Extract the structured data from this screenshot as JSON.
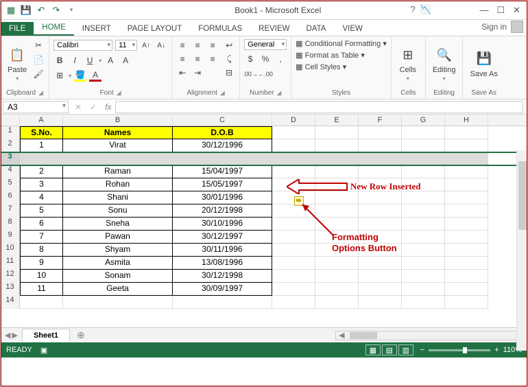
{
  "window": {
    "title": "Book1 - Microsoft Excel",
    "signin": "Sign in"
  },
  "qat": {
    "save": "💾",
    "undo": "↶",
    "redo": "↷"
  },
  "tabs": [
    "FILE",
    "HOME",
    "INSERT",
    "PAGE LAYOUT",
    "FORMULAS",
    "REVIEW",
    "DATA",
    "VIEW"
  ],
  "ribbon": {
    "clipboard": {
      "label": "Clipboard",
      "paste": "Paste"
    },
    "font": {
      "label": "Font",
      "name": "Calibri",
      "size": "11"
    },
    "alignment": {
      "label": "Alignment"
    },
    "number": {
      "label": "Number",
      "format": "General"
    },
    "styles": {
      "label": "Styles",
      "cond": "Conditional Formatting",
      "table": "Format as Table",
      "cell": "Cell Styles"
    },
    "cells": {
      "label": "Cells",
      "btn": "Cells"
    },
    "editing": {
      "label": "Editing",
      "btn": "Editing"
    },
    "saveas": {
      "label": "Save As",
      "btn": "Save As"
    }
  },
  "namebox": "A3",
  "columns": [
    "A",
    "B",
    "C",
    "D",
    "E",
    "F",
    "G",
    "H"
  ],
  "header_row": {
    "a": "S.No.",
    "b": "Names",
    "c": "D.O.B"
  },
  "rows": [
    {
      "n": "1",
      "a": "1",
      "b": "Virat",
      "c": "30/12/1996"
    },
    {
      "n": "2",
      "new": true
    },
    {
      "n": "3",
      "a": "2",
      "b": "Raman",
      "c": "15/04/1997"
    },
    {
      "n": "4",
      "a": "3",
      "b": "Rohan",
      "c": "15/05/1997"
    },
    {
      "n": "5",
      "a": "4",
      "b": "Shani",
      "c": "30/01/1996"
    },
    {
      "n": "6",
      "a": "5",
      "b": "Sonu",
      "c": "20/12/1998"
    },
    {
      "n": "7",
      "a": "6",
      "b": "Sneha",
      "c": "30/10/1996"
    },
    {
      "n": "8",
      "a": "7",
      "b": "Pawan",
      "c": "30/12/1997"
    },
    {
      "n": "9",
      "a": "8",
      "b": "Shyam",
      "c": "30/11/1996"
    },
    {
      "n": "10",
      "a": "9",
      "b": "Asmita",
      "c": "13/08/1996"
    },
    {
      "n": "11",
      "a": "10",
      "b": "Sonam",
      "c": "30/12/1998"
    },
    {
      "n": "12",
      "a": "11",
      "b": "Geeta",
      "c": "30/09/1997"
    }
  ],
  "ann": {
    "newrow": "New Row Inserted",
    "fmtopt_l1": "Formatting",
    "fmtopt_l2": "Options Button"
  },
  "sheet": {
    "name": "Sheet1"
  },
  "status": {
    "ready": "READY",
    "zoom": "110%"
  }
}
